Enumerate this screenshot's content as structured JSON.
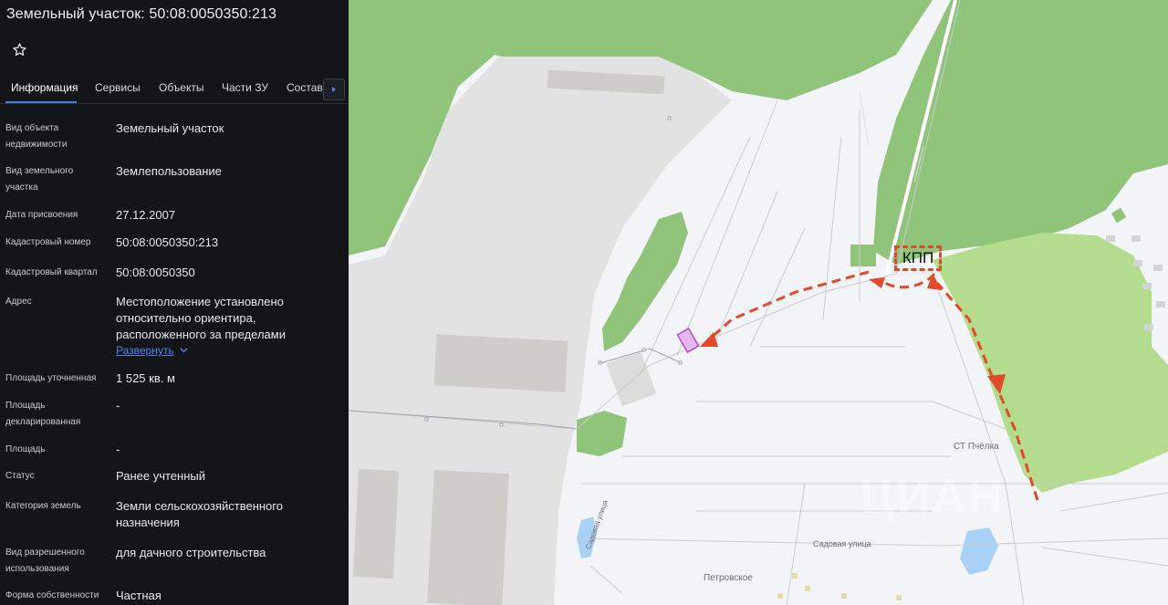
{
  "panel": {
    "title": "Земельный участок: 50:08:0050350:213",
    "tabs": [
      {
        "label": "Информация"
      },
      {
        "label": "Сервисы"
      },
      {
        "label": "Объекты"
      },
      {
        "label": "Части ЗУ"
      },
      {
        "label": "Состав"
      }
    ],
    "expand_label": "Развернуть",
    "rows": [
      {
        "label": "Вид объекта недвижимости",
        "value": "Земельный участок"
      },
      {
        "label": "Вид земельного участка",
        "value": "Землепользование"
      },
      {
        "label": "Дата присвоения",
        "value": "27.12.2007"
      },
      {
        "label": "Кадастровый номер",
        "value": "50:08:0050350:213"
      },
      {
        "label": "Кадастровый квартал",
        "value": "50:08:0050350"
      },
      {
        "label": "Адрес",
        "value": "Местоположение установлено относительно ориентира, расположенного за пределами"
      },
      {
        "label": "Площадь уточненная",
        "value": "1 525 кв. м"
      },
      {
        "label": "Площадь декларированная",
        "value": "-"
      },
      {
        "label": "Площадь",
        "value": "-"
      },
      {
        "label": "Статус",
        "value": "Ранее учтенный"
      },
      {
        "label": "Категория земель",
        "value": "Земли сельскохозяйственного назначения"
      },
      {
        "label": "Вид разрешенного использования",
        "value": "для дачного строительства"
      },
      {
        "label": "Форма собственности",
        "value": "Частная"
      }
    ]
  },
  "map": {
    "labels": {
      "kpp": "КПП",
      "st_pchelka": "СТ Пчёлка",
      "sadovaya_1": "Садовая улица",
      "sadovaya_2": "Садовая улица",
      "petrovskoe": "Петровское",
      "watermark": "ЦИАН"
    },
    "colors": {
      "forest": "#8fc47a",
      "meadow": "#b4dc8e",
      "industrial": "#e2e2e2",
      "building": "#cfcdca",
      "water": "#a9d0f5",
      "route": "#e3492b",
      "parcel": "#c85bd8"
    }
  }
}
